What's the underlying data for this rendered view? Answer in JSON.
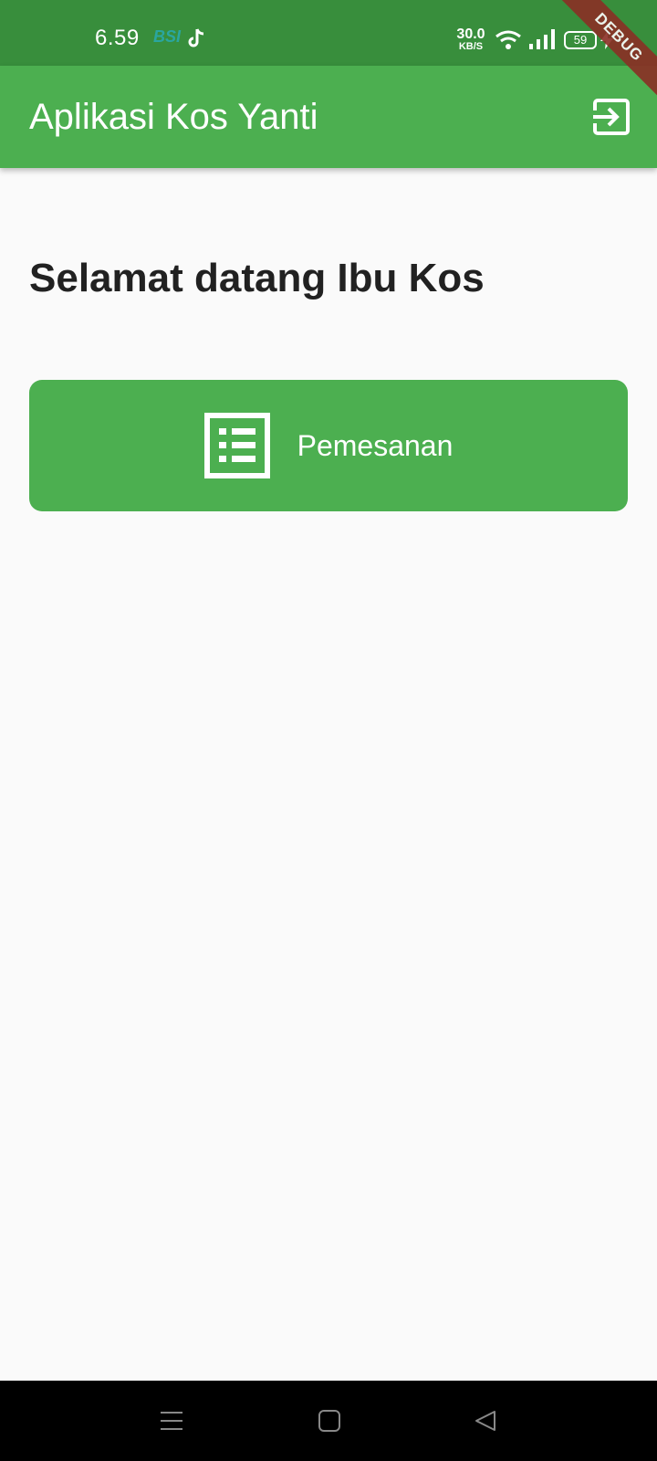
{
  "status_bar": {
    "time": "6.59",
    "bsi_label": "BSI",
    "speed_value": "30.0",
    "speed_unit": "KB/S",
    "battery": "59"
  },
  "debug_banner": "DEBUG",
  "app_bar": {
    "title": "Aplikasi Kos Yanti",
    "logout_icon": "logout-icon"
  },
  "main": {
    "welcome": "Selamat datang Ibu Kos",
    "order_button": {
      "label": "Pemesanan",
      "icon": "list-alt-icon"
    }
  },
  "nav_bar": {
    "menu_icon": "menu-icon",
    "home_icon": "home-square-icon",
    "back_icon": "back-triangle-icon"
  },
  "colors": {
    "status_bar": "#388e3c",
    "primary": "#4caf50",
    "background": "#fafafa",
    "text": "#212121"
  }
}
